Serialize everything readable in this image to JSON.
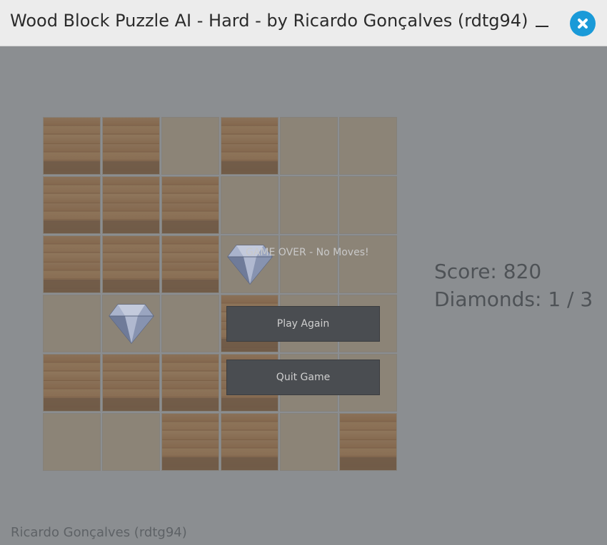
{
  "window": {
    "title": "Wood Block Puzzle AI - Hard - by Ricardo Gonçalves (rdtg94)",
    "minimize_icon": "minimize-icon",
    "close_icon": "close-icon"
  },
  "board": {
    "rows": 6,
    "cols": 6,
    "cells": [
      [
        "wood",
        "wood",
        "empty",
        "wood",
        "empty",
        "empty"
      ],
      [
        "wood",
        "wood",
        "wood",
        "empty",
        "empty",
        "empty"
      ],
      [
        "wood",
        "wood",
        "wood",
        "diamond",
        "empty",
        "empty"
      ],
      [
        "empty",
        "diamond",
        "empty",
        "wood",
        "empty",
        "empty"
      ],
      [
        "wood",
        "wood",
        "wood",
        "wood",
        "empty",
        "empty"
      ],
      [
        "empty",
        "empty",
        "wood",
        "wood",
        "empty",
        "wood"
      ]
    ]
  },
  "overlay": {
    "message": "GAME OVER - No Moves!",
    "play_again_label": "Play Again",
    "quit_label": "Quit Game"
  },
  "stats": {
    "score_text": "Score: 820",
    "diamonds_text": "Diamonds: 1 / 3"
  },
  "footer": {
    "credit": "Ricardo Gonçalves (rdtg94)"
  },
  "colors": {
    "accent": "#1a9ad8",
    "background": "#8b8e91",
    "button": "#4a4d51"
  }
}
